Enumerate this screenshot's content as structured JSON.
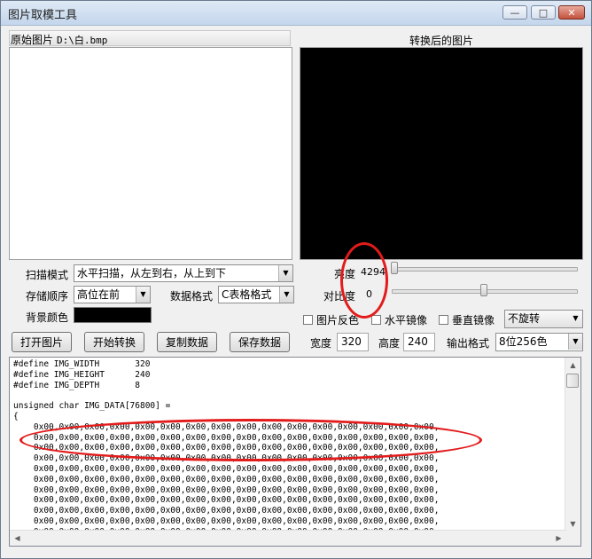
{
  "window": {
    "title": "图片取模工具",
    "controls": {
      "minimize": "—",
      "maximize": "□",
      "close": "✕"
    }
  },
  "original": {
    "label": "原始图片",
    "path": "D:\\白.bmp"
  },
  "converted": {
    "label": "转换后的图片"
  },
  "scan_mode": {
    "label": "扫描模式",
    "value": "水平扫描，从左到右，从上到下"
  },
  "storage_order": {
    "label": "存储顺序",
    "value": "高位在前"
  },
  "data_format": {
    "label": "数据格式",
    "value": "C表格格式"
  },
  "background_color": {
    "label": "背景颜色",
    "color": "#000000"
  },
  "brightness": {
    "label": "亮度",
    "value": "4294",
    "level": 0.0
  },
  "contrast": {
    "label": "对比度",
    "value": "0",
    "level": 0.5
  },
  "invert": {
    "label": "图片反色"
  },
  "h_mirror": {
    "label": "水平镜像"
  },
  "v_mirror": {
    "label": "垂直镜像"
  },
  "rotate": {
    "value": "不旋转"
  },
  "buttons": {
    "open": "打开图片",
    "convert": "开始转换",
    "copy": "复制数据",
    "save": "保存数据"
  },
  "width": {
    "label": "宽度",
    "value": "320"
  },
  "height": {
    "label": "高度",
    "value": "240"
  },
  "output_format": {
    "label": "输出格式",
    "value": "8位256色"
  },
  "code": {
    "lines": [
      "#define IMG_WIDTH       320",
      "#define IMG_HEIGHT      240",
      "#define IMG_DEPTH       8",
      "",
      "unsigned char IMG_DATA[76800] =",
      "{",
      "    0x00,0x00,0x00,0x00,0x00,0x00,0x00,0x00,0x00,0x00,0x00,0x00,0x00,0x00,0x00,0x00,",
      "    0x00,0x00,0x00,0x00,0x00,0x00,0x00,0x00,0x00,0x00,0x00,0x00,0x00,0x00,0x00,0x00,",
      "    0x00,0x00,0x00,0x00,0x00,0x00,0x00,0x00,0x00,0x00,0x00,0x00,0x00,0x00,0x00,0x00,",
      "    0x00,0x00,0x00,0x00,0x00,0x00,0x00,0x00,0x00,0x00,0x00,0x00,0x00,0x00,0x00,0x00,",
      "    0x00,0x00,0x00,0x00,0x00,0x00,0x00,0x00,0x00,0x00,0x00,0x00,0x00,0x00,0x00,0x00,",
      "    0x00,0x00,0x00,0x00,0x00,0x00,0x00,0x00,0x00,0x00,0x00,0x00,0x00,0x00,0x00,0x00,",
      "    0x00,0x00,0x00,0x00,0x00,0x00,0x00,0x00,0x00,0x00,0x00,0x00,0x00,0x00,0x00,0x00,",
      "    0x00,0x00,0x00,0x00,0x00,0x00,0x00,0x00,0x00,0x00,0x00,0x00,0x00,0x00,0x00,0x00,",
      "    0x00,0x00,0x00,0x00,0x00,0x00,0x00,0x00,0x00,0x00,0x00,0x00,0x00,0x00,0x00,0x00,",
      "    0x00,0x00,0x00,0x00,0x00,0x00,0x00,0x00,0x00,0x00,0x00,0x00,0x00,0x00,0x00,0x00,",
      "    0x00,0x00,0x00,0x00,0x00,0x00,0x00,0x00,0x00,0x00,0x00,0x00,0x00,0x00,0x00,0x00,"
    ]
  },
  "annotation_color": "#e31b1b"
}
